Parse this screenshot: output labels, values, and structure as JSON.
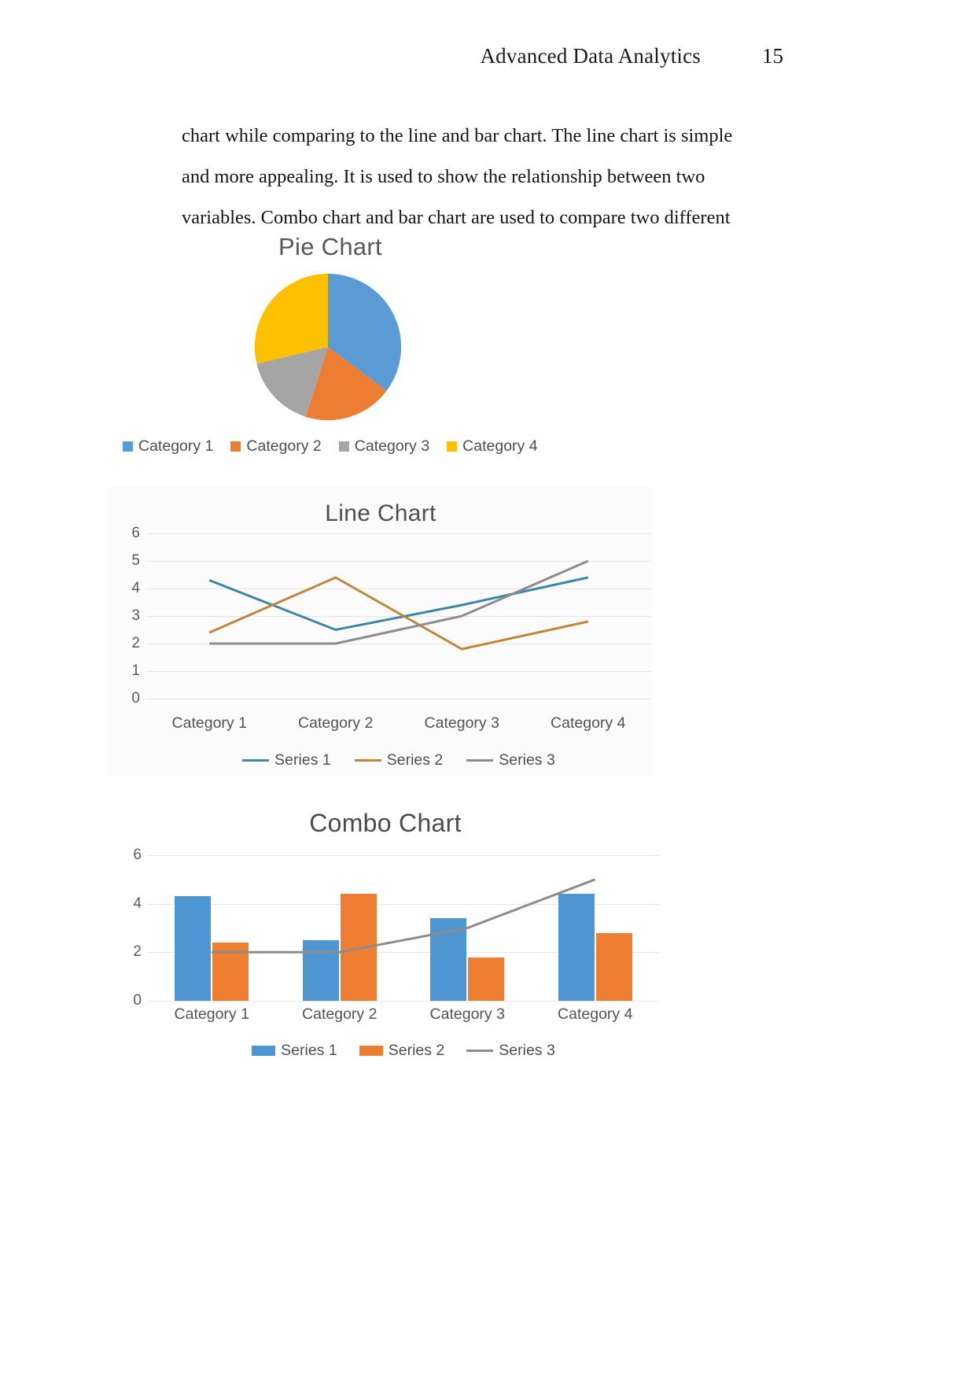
{
  "header": {
    "title": "Advanced Data Analytics",
    "page_number": "15"
  },
  "body": {
    "paragraph": "chart while comparing to the line and bar chart. The line chart is simple and more appealing. It is used to show the relationship between two variables. Combo chart and bar chart are used to compare two different patterns"
  },
  "colors": {
    "series1_blue": "#4a90c4",
    "series2_orange": "#ed7d31",
    "series3_gray": "#a5a5a5",
    "category4_yellow": "#ffc000",
    "bar_blue": "#4e96d1",
    "bar_orange": "#ed7d31",
    "combo_line_gray": "#8c8c8c",
    "gridline": "#e6e6e6",
    "title_text": "#565656"
  },
  "charts": {
    "pie": {
      "title": "Pie Chart",
      "legend": [
        {
          "label": "Category 1",
          "color": "#5b9bd5"
        },
        {
          "label": "Category 2",
          "color": "#ed7d31"
        },
        {
          "label": "Category 3",
          "color": "#a5a5a5"
        },
        {
          "label": "Category 4",
          "color": "#ffc000"
        }
      ]
    },
    "line": {
      "title": "Line Chart",
      "legend": [
        {
          "label": "Series 1",
          "color": "#3b87a8"
        },
        {
          "label": "Series 2",
          "color": "#c0863c"
        },
        {
          "label": "Series 3",
          "color": "#8c8c8c"
        }
      ]
    },
    "combo": {
      "title": "Combo Chart",
      "legend": [
        {
          "label": "Series 1",
          "color": "#4e96d1",
          "marker": "bar"
        },
        {
          "label": "Series 2",
          "color": "#ed7d31",
          "marker": "bar"
        },
        {
          "label": "Series 3",
          "color": "#8c8c8c",
          "marker": "line"
        }
      ]
    }
  },
  "chart_data": [
    {
      "type": "pie",
      "title": "Pie Chart",
      "labels": [
        "Category 1",
        "Category 2",
        "Category 3",
        "Category 4"
      ],
      "values": [
        4.3,
        2.4,
        2.0,
        3.5
      ],
      "percentages": [
        35.2,
        19.7,
        16.4,
        28.7
      ],
      "colors": [
        "#5b9bd5",
        "#ed7d31",
        "#a5a5a5",
        "#ffc000"
      ],
      "legend_position": "bottom",
      "grid": false
    },
    {
      "type": "line",
      "title": "Line Chart",
      "categories": [
        "Category 1",
        "Category 2",
        "Category 3",
        "Category 4"
      ],
      "series": [
        {
          "name": "Series 1",
          "values": [
            4.3,
            2.5,
            3.4,
            4.4
          ],
          "color": "#3b87a8"
        },
        {
          "name": "Series 2",
          "values": [
            2.4,
            4.4,
            1.8,
            2.8
          ],
          "color": "#c0863c"
        },
        {
          "name": "Series 3",
          "values": [
            2.0,
            2.0,
            3.0,
            5.0
          ],
          "color": "#8c8c8c"
        }
      ],
      "yticks": [
        6,
        5,
        4,
        3,
        2,
        1,
        0
      ],
      "ylim": [
        0,
        6
      ],
      "xlabel": "",
      "ylabel": "",
      "grid": true,
      "legend_position": "bottom"
    },
    {
      "type": "bar",
      "title": "Combo Chart",
      "categories": [
        "Category 1",
        "Category 2",
        "Category 3",
        "Category 4"
      ],
      "series": [
        {
          "name": "Series 1",
          "type": "bar",
          "values": [
            4.3,
            2.5,
            3.4,
            4.4
          ],
          "color": "#4e96d1"
        },
        {
          "name": "Series 2",
          "type": "bar",
          "values": [
            2.4,
            4.4,
            1.8,
            2.8
          ],
          "color": "#ed7d31"
        },
        {
          "name": "Series 3",
          "type": "line",
          "values": [
            2.0,
            2.0,
            3.0,
            5.0
          ],
          "color": "#8c8c8c"
        }
      ],
      "yticks": [
        6,
        4,
        2,
        0
      ],
      "ylim": [
        0,
        6
      ],
      "xlabel": "",
      "ylabel": "",
      "grid": true,
      "legend_position": "bottom"
    }
  ]
}
